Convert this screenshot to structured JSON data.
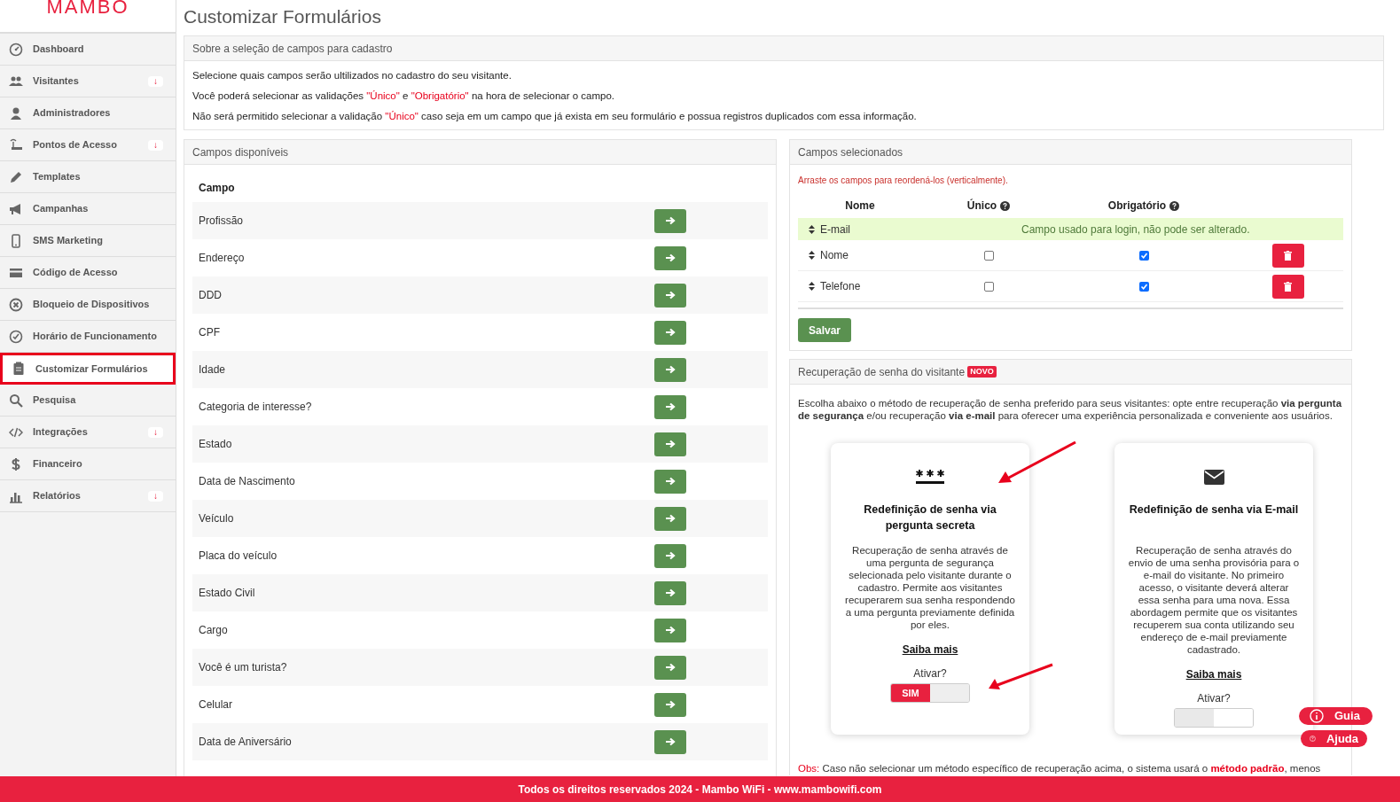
{
  "logo": "MAMBO",
  "sidebar": {
    "items": [
      {
        "label": "Dashboard",
        "selected": false
      },
      {
        "label": "Visitantes",
        "badge": "↓",
        "selected": false
      },
      {
        "label": "Administradores",
        "selected": false
      },
      {
        "label": "Pontos de Acesso",
        "badge": "↓",
        "selected": false
      },
      {
        "label": "Templates",
        "selected": false
      },
      {
        "label": "Campanhas",
        "selected": false
      },
      {
        "label": "SMS Marketing",
        "selected": false
      },
      {
        "label": "Código de Acesso",
        "selected": false
      },
      {
        "label": "Bloqueio de Dispositivos",
        "selected": false
      },
      {
        "label": "Horário de Funcionamento",
        "selected": false
      },
      {
        "label": "Customizar Formulários",
        "selected": true
      },
      {
        "label": "Pesquisa",
        "selected": false
      },
      {
        "label": "Integrações",
        "badge": "↓",
        "selected": false
      },
      {
        "label": "Financeiro",
        "selected": false
      },
      {
        "label": "Relatórios",
        "badge": "↓",
        "selected": false
      }
    ]
  },
  "page_title": "Customizar Formulários",
  "about": {
    "title": "Sobre a seleção de campos para cadastro",
    "lines": [
      [
        {
          "text": "Selecione quais campos serão ultilizados no cadastro do seu visitante.",
          "highlight": false
        }
      ],
      [
        {
          "text": "Você poderá selecionar as validações ",
          "highlight": false
        },
        {
          "text": "\"Único\"",
          "highlight": true
        },
        {
          "text": " e ",
          "highlight": false
        },
        {
          "text": "\"Obrigatório\"",
          "highlight": true
        },
        {
          "text": " na hora de selecionar o campo.",
          "highlight": false
        }
      ],
      [
        {
          "text": "Não será permitido selecionar a validação ",
          "highlight": false
        },
        {
          "text": "\"Único\"",
          "highlight": true
        },
        {
          "text": " caso seja em um campo que já exista em seu formulário e possua registros duplicados com essa informação.",
          "highlight": false
        }
      ]
    ]
  },
  "available": {
    "title": "Campos disponíveis",
    "column": "Campo",
    "rows": [
      "Profissão",
      "Endereço",
      "DDD",
      "CPF",
      "Idade",
      "Categoria de interesse?",
      "Estado",
      "Data de Nascimento",
      "Veículo",
      "Placa do veículo",
      "Estado Civil",
      "Cargo",
      "Você é um turista?",
      "Celular",
      "Data de Aniversário"
    ]
  },
  "selected": {
    "title": "Campos selecionados",
    "hint": "Arraste os campos para reordená-los (verticalmente).",
    "columns": [
      {
        "label": "Nome",
        "help": false
      },
      {
        "label": "Único",
        "help": true
      },
      {
        "label": "Obrigatório",
        "help": true
      }
    ],
    "rows": [
      {
        "kind": "locked",
        "name": "E-mail",
        "note": "Campo usado para login, não pode ser alterado."
      },
      {
        "kind": "editable",
        "name": "Nome",
        "unique": false,
        "required": true
      },
      {
        "kind": "editable",
        "name": "Telefone",
        "unique": false,
        "required": true
      }
    ],
    "save": "Salvar"
  },
  "recovery": {
    "title": "Recuperação de senha do visitante",
    "badge": "NOVO",
    "intro": "Escolha abaixo o método de recuperação de senha preferido para seus visitantes: opte entre recuperação **via pergunta de segurança** e/ou recuperação **via e-mail** para oferecer uma experiência personalizada e conveniente aos usuários.",
    "cards": [
      {
        "title": "Redefinição de senha via pergunta secreta",
        "description": "Recuperação de senha através de uma pergunta de segurança selecionada pelo visitante durante o cadastro. Permite aos visitantes recuperarem sua senha respondendo a uma pergunta previamente definida por eles.",
        "link": "Saiba mais",
        "prompt": "Ativar?",
        "on": true,
        "on_label": "SIM"
      },
      {
        "title": "Redefinição de senha via E-mail",
        "description": "Recuperação de senha através do envio de uma senha provisória para o e-mail do visitante. No primeiro acesso, o visitante deverá alterar essa senha para uma nova. Essa abordagem permite que os visitantes recuperem sua conta utilizando seu endereço de e-mail previamente cadastrado.",
        "link": "Saiba mais",
        "prompt": "Ativar?",
        "on": false
      }
    ],
    "note": [
      {
        "text": "Obs:",
        "highlight": true,
        "bold": false
      },
      {
        "text": " Caso não selecionar um método específico de recuperação acima, o sistema usará o ",
        "highlight": false,
        "bold": false
      },
      {
        "text": "método padrão",
        "highlight": true,
        "bold": true
      },
      {
        "text": ", menos",
        "highlight": false,
        "bold": false
      }
    ]
  },
  "floating": [
    {
      "label": "Guia"
    },
    {
      "label": "Ajuda"
    }
  ],
  "footer": "Todos os direitos reservados 2024 - Mambo WiFi - www.mambowifi.com"
}
